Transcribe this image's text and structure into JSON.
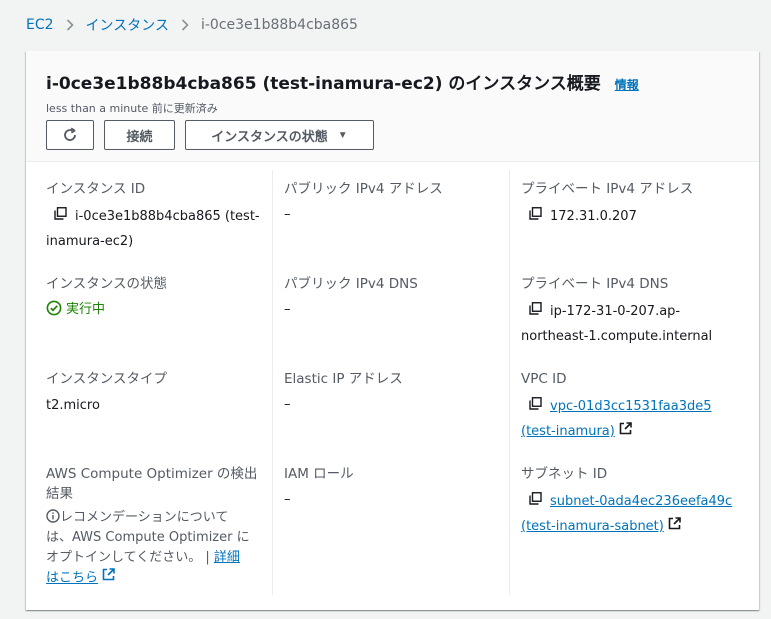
{
  "breadcrumb": {
    "root": "EC2",
    "section": "インスタンス",
    "current": "i-0ce3e1b88b4cba865"
  },
  "header": {
    "title": "i-0ce3e1b88b4cba865 (test-inamura-ec2) のインスタンス概要",
    "info_label": "情報",
    "updated": "less than a minute 前に更新済み",
    "connect_label": "接続",
    "state_label": "インスタンスの状態"
  },
  "details": {
    "instance_id_label": "インスタンス ID",
    "instance_id_value_a": "i-0ce3e1b88b4cba865 (test-",
    "instance_id_value_b": "inamura-ec2)",
    "public_ipv4_label": "パブリック IPv4 アドレス",
    "public_ipv4_value": "–",
    "private_ipv4_label": "プライベート IPv4 アドレス",
    "private_ipv4_value": "172.31.0.207",
    "instance_state_label": "インスタンスの状態",
    "instance_state_value": "実行中",
    "public_dns_label": "パブリック IPv4 DNS",
    "public_dns_value": "–",
    "private_dns_label": "プライベート IPv4 DNS",
    "private_dns_value_a": "ip-172-31-0-207.ap-",
    "private_dns_value_b": "northeast-1.compute.internal",
    "instance_type_label": "インスタンスタイプ",
    "instance_type_value": "t2.micro",
    "elastic_ip_label": "Elastic IP アドレス",
    "elastic_ip_value": "–",
    "vpc_label": "VPC ID",
    "vpc_value_a": "vpc-01d3cc1531faa3de5",
    "vpc_value_b": "(test-inamura)",
    "optimizer_label_a": "AWS Compute Optimizer の検出",
    "optimizer_label_b": "結果",
    "optimizer_note_a": "レコメンデーションについて",
    "optimizer_note_b": "は、AWS Compute Optimizer に",
    "optimizer_note_c": "オプトインしてください。 | ",
    "optimizer_link_a": "詳細",
    "optimizer_link_b": "はこちら",
    "iam_label": "IAM ロール",
    "iam_value": "–",
    "subnet_label": "サブネット ID",
    "subnet_value_a": "subnet-0ada4ec236eefa49c",
    "subnet_value_b": "(test-inamura-sabnet)"
  },
  "colors": {
    "link": "#0073bb",
    "success": "#1d8102",
    "label": "#545b64"
  }
}
